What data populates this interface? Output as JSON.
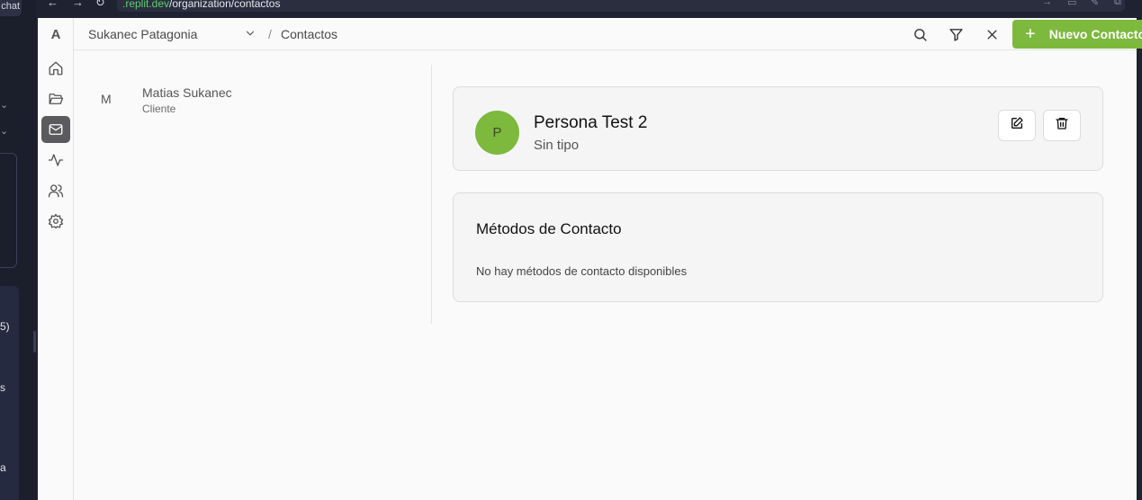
{
  "browser": {
    "url_host": ".replit.dev",
    "url_path": "/organization/contactos"
  },
  "outer": {
    "chat_tab": "chat",
    "fragments": [
      "5)",
      "s",
      "a"
    ]
  },
  "app": {
    "logo": "A",
    "rail": [
      {
        "icon": "home-icon"
      },
      {
        "icon": "folder-icon"
      },
      {
        "icon": "mail-icon",
        "active": true
      },
      {
        "icon": "activity-icon"
      },
      {
        "icon": "users-icon"
      },
      {
        "icon": "settings-icon"
      }
    ]
  },
  "header": {
    "organization": "Sukanec Patagonia",
    "separator": "/",
    "page": "Contactos",
    "new_button": "Nuevo Contacto",
    "new_button_icon": "+"
  },
  "contacts": [
    {
      "initial": "M",
      "name": "Matias Sukanec",
      "role": "Cliente"
    }
  ],
  "selected": {
    "initial": "P",
    "name": "Persona Test 2",
    "type": "Sin tipo"
  },
  "methods": {
    "title": "Métodos de Contacto",
    "empty": "No hay métodos de contacto disponibles"
  },
  "colors": {
    "accent": "#7cb93c",
    "rail_active": "#5b5b5f"
  }
}
